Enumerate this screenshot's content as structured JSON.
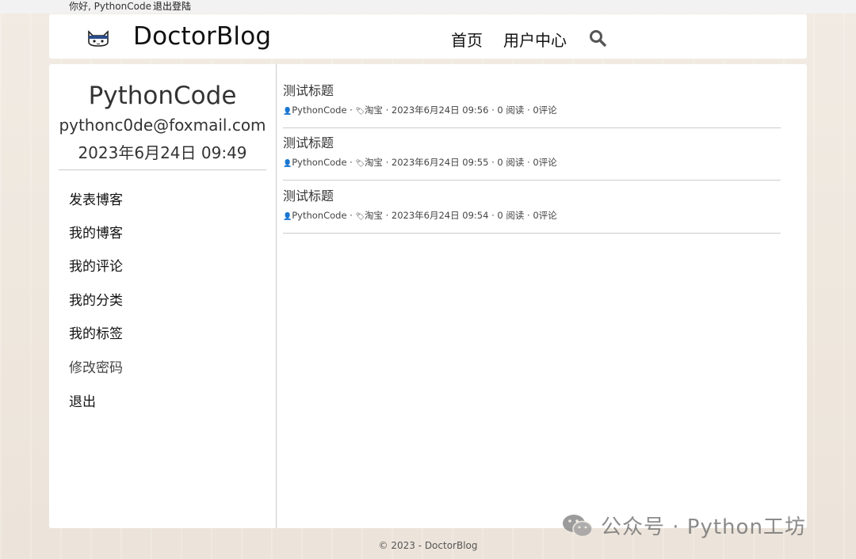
{
  "topbar": {
    "greeting": "你好, PythonCode",
    "logout": "退出登陆"
  },
  "header": {
    "brand": "DoctorBlog",
    "logo_icon": "cat-face-icon",
    "nav": [
      "首页",
      "用户中心"
    ],
    "search_icon": "search-icon"
  },
  "profile": {
    "name": "PythonCode",
    "email": "pythonc0de@foxmail.com",
    "joined": "2023年6月24日 09:49"
  },
  "menu": [
    {
      "label": "发表博客"
    },
    {
      "label": "我的博客"
    },
    {
      "label": "我的评论"
    },
    {
      "label": "我的分类"
    },
    {
      "label": "我的标签"
    },
    {
      "label": "修改密码"
    },
    {
      "label": "退出"
    }
  ],
  "posts": [
    {
      "title": "测试标题",
      "author": "PythonCode",
      "category": "淘宝",
      "datetime": "2023年6月24日 09:56",
      "reads": "0 阅读",
      "comments": "0评论"
    },
    {
      "title": "测试标题",
      "author": "PythonCode",
      "category": "淘宝",
      "datetime": "2023年6月24日 09:55",
      "reads": "0 阅读",
      "comments": "0评论"
    },
    {
      "title": "测试标题",
      "author": "PythonCode",
      "category": "淘宝",
      "datetime": "2023年6月24日 09:54",
      "reads": "0 阅读",
      "comments": "0评论"
    }
  ],
  "meta_separator": " · ",
  "footer": "© 2023 - DoctorBlog",
  "watermark": {
    "text": "公众号 · Python工坊",
    "icon": "wechat-icon"
  },
  "colors": {
    "background": "#efe8df",
    "panel": "#ffffff",
    "text": "#222222",
    "divider": "#cccccc"
  }
}
